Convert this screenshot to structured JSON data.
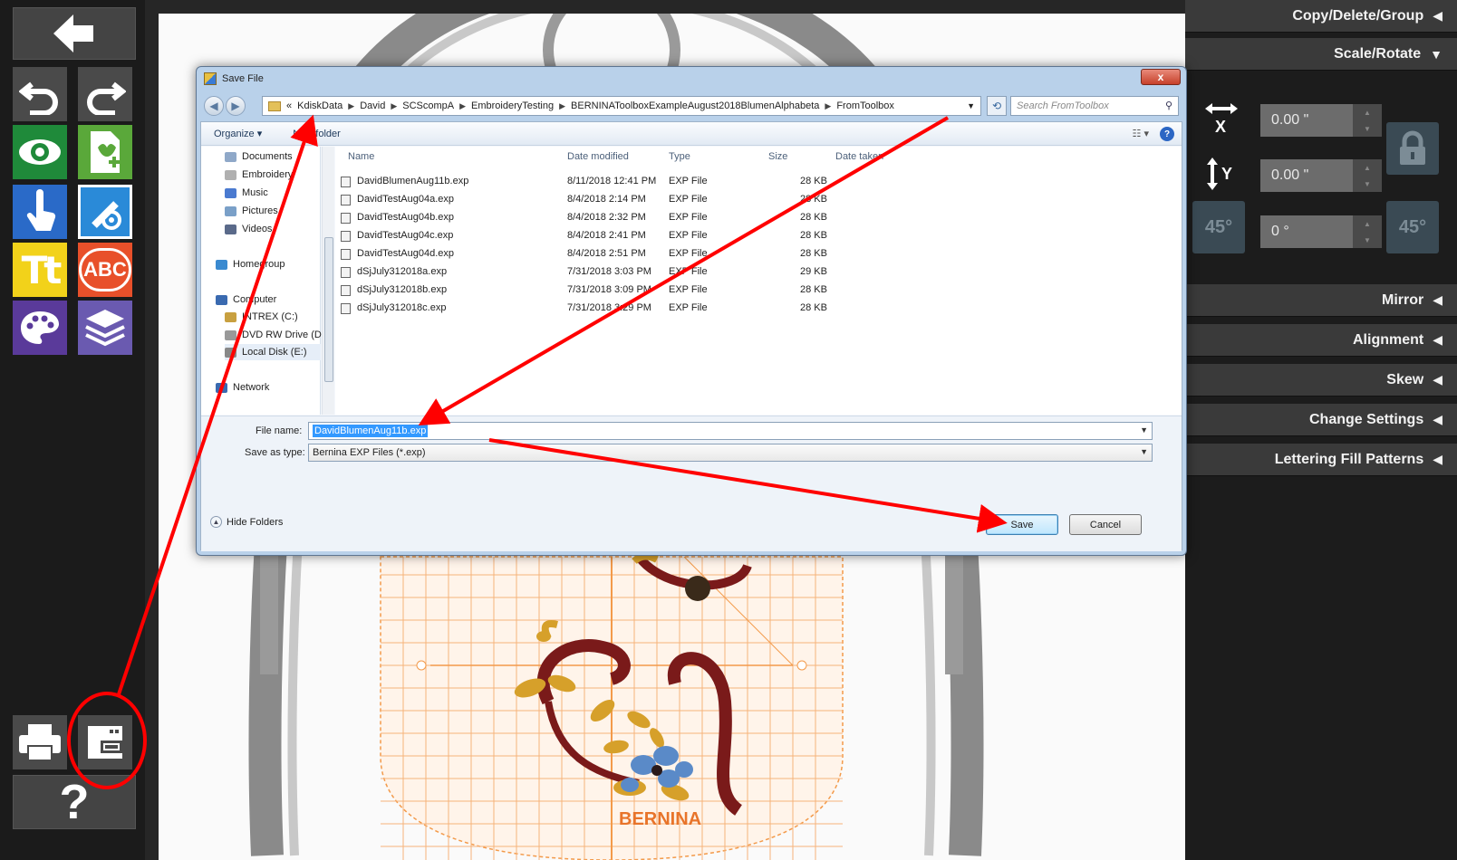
{
  "right_panel": {
    "sections_top": [
      {
        "label": "Copy/Delete/Group",
        "arrow": "◀"
      },
      {
        "label": "Scale/Rotate",
        "arrow": "▼"
      }
    ],
    "scale": {
      "x_label": "X",
      "y_label": "Y",
      "x_value": "0.00 \"",
      "y_value": "0.00 \"",
      "rotate_value": "0 °",
      "rotate_left_label": "45°",
      "rotate_right_label": "45°"
    },
    "sections_bottom": [
      {
        "label": "Mirror",
        "arrow": "◀"
      },
      {
        "label": "Alignment",
        "arrow": "◀"
      },
      {
        "label": "Skew",
        "arrow": "◀"
      },
      {
        "label": "Change Settings",
        "arrow": "◀"
      },
      {
        "label": "Lettering Fill Patterns",
        "arrow": "◀"
      }
    ]
  },
  "toolbar": {
    "help_label": "?",
    "text_tool_label": "Tt",
    "monogram_label": "ABC"
  },
  "canvas": {
    "brand_label": "BERNINA"
  },
  "dialog": {
    "title": "Save File",
    "close_label": "x",
    "breadcrumbs": [
      "«",
      "KdiskData",
      "David",
      "SCScompA",
      "EmbroideryTesting",
      "BERNINAToolboxExampleAugust2018BlumenAlphabeta",
      "FromToolbox"
    ],
    "search_placeholder": "Search FromToolbox",
    "organize_label": "Organize ▾",
    "new_folder_label": "New folder",
    "nav_items": [
      {
        "label": "Documents",
        "color": "#8fa8c8"
      },
      {
        "label": "Embroidery",
        "color": "#b0b0b0"
      },
      {
        "label": "Music",
        "color": "#4a7ad0"
      },
      {
        "label": "Pictures",
        "color": "#7aa0c8"
      },
      {
        "label": "Videos",
        "color": "#5a6a8a"
      },
      {
        "label": "Homegroup",
        "color": "#3a8ad0"
      },
      {
        "label": "Computer",
        "color": "#3a6ab0"
      },
      {
        "label": "INTREX (C:)",
        "color": "#c8a040"
      },
      {
        "label": "DVD RW Drive (D:)",
        "color": "#999999"
      },
      {
        "label": "Local Disk (E:)",
        "color": "#888888"
      },
      {
        "label": "Network",
        "color": "#3a6ab0"
      }
    ],
    "columns": [
      "Name",
      "Date modified",
      "Type",
      "Size",
      "Date taken"
    ],
    "files": [
      {
        "name": "DavidBlumenAug11b.exp",
        "date": "8/11/2018 12:41 PM",
        "type": "EXP File",
        "size": "28 KB"
      },
      {
        "name": "DavidTestAug04a.exp",
        "date": "8/4/2018 2:14 PM",
        "type": "EXP File",
        "size": "28 KB"
      },
      {
        "name": "DavidTestAug04b.exp",
        "date": "8/4/2018 2:32 PM",
        "type": "EXP File",
        "size": "28 KB"
      },
      {
        "name": "DavidTestAug04c.exp",
        "date": "8/4/2018 2:41 PM",
        "type": "EXP File",
        "size": "28 KB"
      },
      {
        "name": "DavidTestAug04d.exp",
        "date": "8/4/2018 2:51 PM",
        "type": "EXP File",
        "size": "28 KB"
      },
      {
        "name": "dSjJuly312018a.exp",
        "date": "7/31/2018 3:03 PM",
        "type": "EXP File",
        "size": "29 KB"
      },
      {
        "name": "dSjJuly312018b.exp",
        "date": "7/31/2018 3:09 PM",
        "type": "EXP File",
        "size": "28 KB"
      },
      {
        "name": "dSjJuly312018c.exp",
        "date": "7/31/2018 3:29 PM",
        "type": "EXP File",
        "size": "28 KB"
      }
    ],
    "file_name_label": "File name:",
    "file_name_value": "DavidBlumenAug11b.exp",
    "save_type_label": "Save as type:",
    "save_type_value": "Bernina EXP Files (*.exp)",
    "hide_folders_label": "Hide Folders",
    "save_label": "Save",
    "cancel_label": "Cancel"
  },
  "colors": {
    "annotation_red": "#ff0000",
    "grid_orange": "#f39a4a",
    "hoop_gray": "#8a8a8a",
    "thread_maroon": "#7a1a1a",
    "thread_gold": "#d6a02a",
    "thread_blue": "#5a8ac8"
  }
}
